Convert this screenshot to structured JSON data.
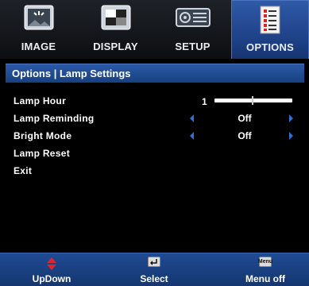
{
  "tabs": [
    {
      "label": "IMAGE",
      "icon": "image-tab-icon",
      "active": false
    },
    {
      "label": "DISPLAY",
      "icon": "display-tab-icon",
      "active": false
    },
    {
      "label": "SETUP",
      "icon": "setup-tab-icon",
      "active": false
    },
    {
      "label": "OPTIONS",
      "icon": "options-tab-icon",
      "active": true
    }
  ],
  "title": "Options | Lamp Settings",
  "rows": {
    "lamp_hour": {
      "label": "Lamp Hour",
      "value": "1"
    },
    "lamp_reminding": {
      "label": "Lamp Reminding",
      "value": "Off"
    },
    "bright_mode": {
      "label": "Bright Mode",
      "value": "Off"
    },
    "lamp_reset": {
      "label": "Lamp Reset"
    },
    "exit": {
      "label": "Exit"
    }
  },
  "footer": {
    "updown": "UpDown",
    "select": "Select",
    "menu_off": "Menu off",
    "menu_key": "Menu"
  },
  "colors": {
    "accent": "#1d3f86",
    "arrow": "#2f6fd0",
    "updown_icon": "#e0242e"
  }
}
